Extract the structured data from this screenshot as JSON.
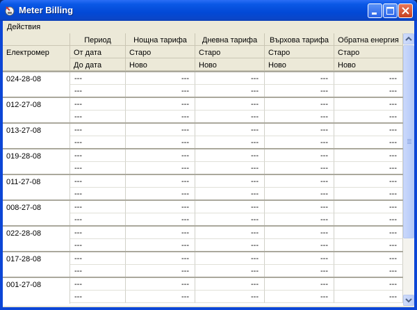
{
  "window": {
    "title": "Meter Billing"
  },
  "menu": {
    "items": [
      "Действия"
    ]
  },
  "grid": {
    "meter_header": "Електромер",
    "column_headers": [
      "Период",
      "Нощна тарифа",
      "Дневна тарифа",
      "Върхова тарифа",
      "Обратна енергия"
    ],
    "row1_labels": [
      "От дата",
      "Старо",
      "Старо",
      "Старо",
      "Старо"
    ],
    "row2_labels": [
      "До дата",
      "Ново",
      "Ново",
      "Ново",
      "Ново"
    ],
    "empty_value": "---",
    "meters": [
      "024-28-08",
      "012-27-08",
      "013-27-08",
      "019-28-08",
      "011-27-08",
      "008-27-08",
      "022-28-08",
      "017-28-08",
      "001-27-08"
    ]
  },
  "colors": {
    "title_bar": "#0a58e6",
    "close_button": "#c63e1e",
    "header_bg": "#ece9d8"
  },
  "icons": {
    "app": "meter-app-icon",
    "minimize": "minimize-icon",
    "maximize": "maximize-icon",
    "close": "close-icon",
    "scroll_up": "scroll-up-arrow-icon",
    "scroll_down": "scroll-down-arrow-icon"
  }
}
